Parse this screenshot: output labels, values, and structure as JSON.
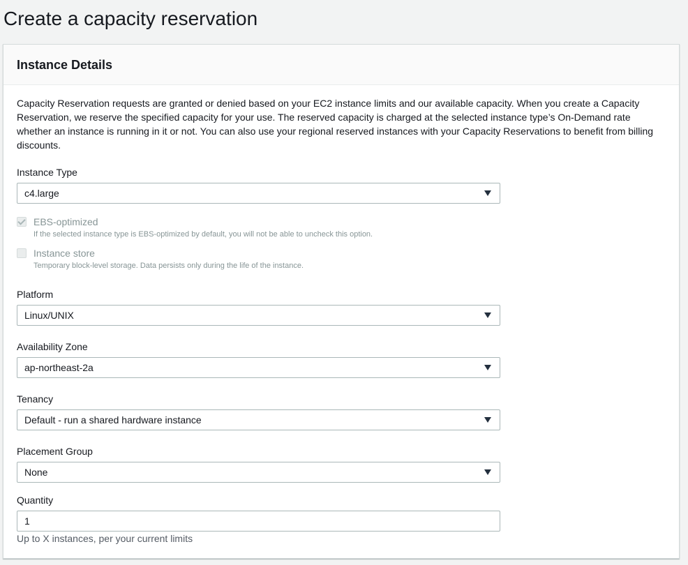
{
  "page": {
    "title": "Create a capacity reservation"
  },
  "panel": {
    "title": "Instance Details",
    "description": "Capacity Reservation requests are granted or denied based on your EC2 instance limits and our available capacity. When you create a Capacity Reservation, we reserve the specified capacity for your use. The reserved capacity is charged at the selected instance type’s On-Demand rate whether an instance is running in it or not. You can also use your regional reserved instances with your Capacity Reservations to benefit from billing discounts."
  },
  "fields": {
    "instance_type": {
      "label": "Instance Type",
      "value": "c4.large"
    },
    "ebs_optimized": {
      "label": "EBS-optimized",
      "help": "If the selected instance type is EBS-optimized by default, you will not be able to uncheck this option.",
      "checked": true,
      "disabled": true
    },
    "instance_store": {
      "label": "Instance store",
      "help": "Temporary block-level storage. Data persists only during the life of the instance.",
      "checked": false,
      "disabled": true
    },
    "platform": {
      "label": "Platform",
      "value": "Linux/UNIX"
    },
    "availability_zone": {
      "label": "Availability Zone",
      "value": "ap-northeast-2a"
    },
    "tenancy": {
      "label": "Tenancy",
      "value": "Default - run a shared hardware instance"
    },
    "placement_group": {
      "label": "Placement Group",
      "value": "None"
    },
    "quantity": {
      "label": "Quantity",
      "value": "1",
      "hint": "Up to X instances, per your current limits"
    }
  },
  "icons": {
    "dropdown": "caret-down-icon",
    "checkbox": "checkmark-icon"
  },
  "colors": {
    "background": "#f2f3f3",
    "panel_header": "#fafafa",
    "border": "#aab7b8",
    "text": "#16191f",
    "disabled_text": "#879596"
  }
}
